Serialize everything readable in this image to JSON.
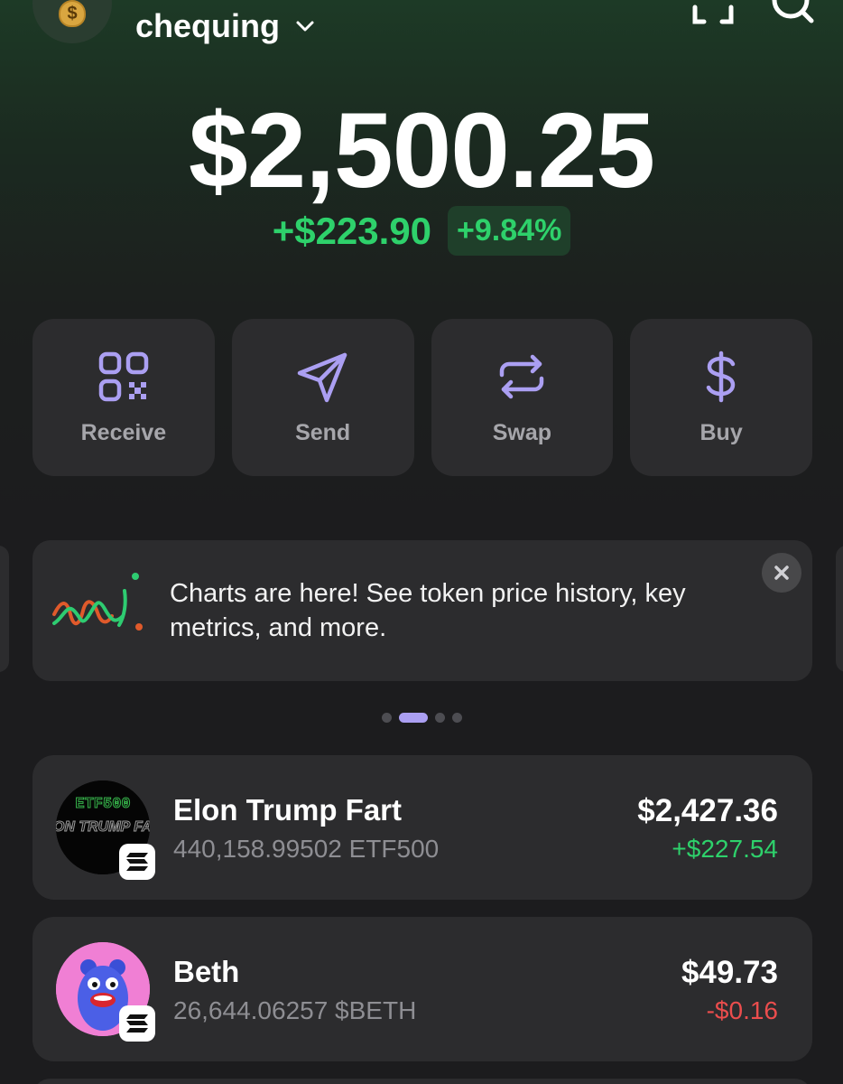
{
  "header": {
    "account_name": "chequing",
    "avatar_symbol": "$"
  },
  "balance": {
    "total": "$2,500.25",
    "change_abs": "+$223.90",
    "change_pct": "+9.84%"
  },
  "actions": [
    {
      "label": "Receive",
      "icon": "qr-code-icon"
    },
    {
      "label": "Send",
      "icon": "send-icon"
    },
    {
      "label": "Swap",
      "icon": "swap-icon"
    },
    {
      "label": "Buy",
      "icon": "dollar-icon"
    }
  ],
  "banner": {
    "text": "Charts are here! See token price history, key metrics, and more.",
    "icon": "chart-squiggle-icon",
    "close_icon": "close-icon"
  },
  "carousel": {
    "count": 4,
    "active_index": 1
  },
  "tokens": [
    {
      "name": "Elon Trump Fart",
      "amount": "440,158.99502 ETF500",
      "value": "$2,427.36",
      "change": "+$227.54",
      "direction": "up",
      "logo_text_top": "ETF500",
      "logo_text_body": "ELON TRUMP FART"
    },
    {
      "name": "Beth",
      "amount": "26,644.06257 $BETH",
      "value": "$49.73",
      "change": "-$0.16",
      "direction": "down"
    }
  ],
  "colors": {
    "accent": "#ab9ff2",
    "positive": "#2ed16b",
    "negative": "#eb4d4d",
    "card": "#2c2c2e",
    "background": "#1c1c1e"
  }
}
